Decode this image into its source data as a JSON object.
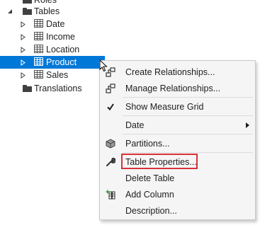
{
  "tree": {
    "roles_label": "Roles",
    "tables_label": "Tables",
    "tables": [
      {
        "label": "Date"
      },
      {
        "label": "Income"
      },
      {
        "label": "Location"
      },
      {
        "label": "Product",
        "selected": true
      },
      {
        "label": "Sales"
      }
    ],
    "translations_label": "Translations"
  },
  "context_menu": {
    "create_relationships": "Create Relationships...",
    "manage_relationships": "Manage Relationships...",
    "show_measure_grid": "Show Measure Grid",
    "date": "Date",
    "partitions": "Partitions...",
    "table_properties": "Table Properties...",
    "delete_table": "Delete Table",
    "add_column": "Add Column",
    "description": "Description..."
  },
  "colors": {
    "selection": "#0078d7",
    "highlight_box": "#d9303a",
    "menu_bg": "#f5f5f5"
  }
}
